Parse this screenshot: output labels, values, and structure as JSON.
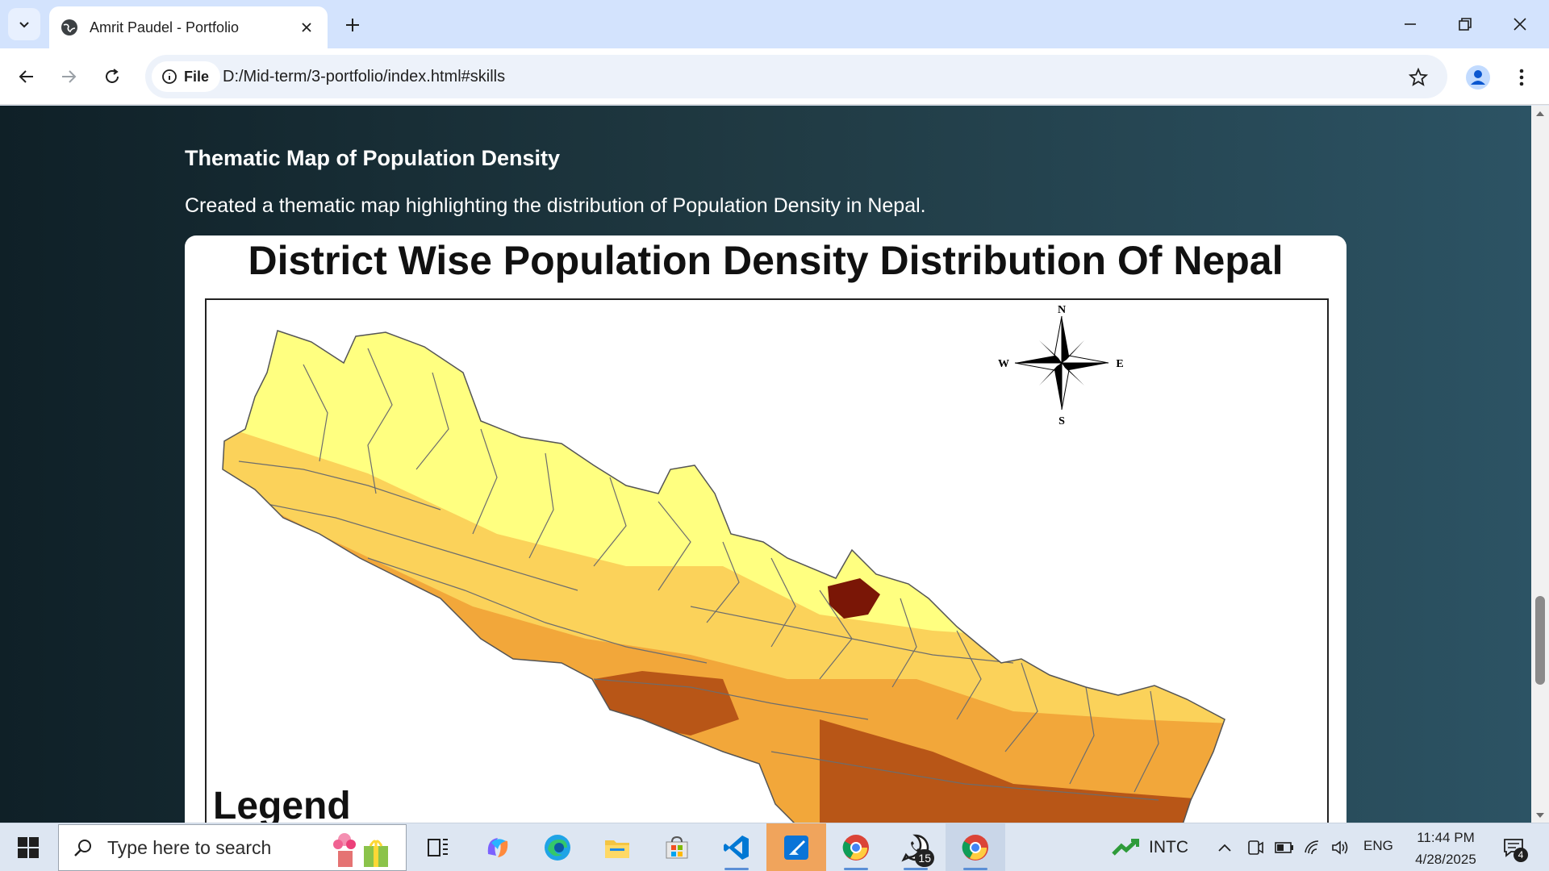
{
  "browser": {
    "tab": {
      "title": "Amrit Paudel - Portfolio"
    },
    "address": {
      "chip_label": "File",
      "url": "D:/Mid-term/3-portfolio/index.html#skills"
    }
  },
  "page": {
    "section_title": "Thematic Map of Population Density",
    "section_desc": "Created a thematic map highlighting the distribution of Population Density in Nepal.",
    "map": {
      "title": "District Wise Population Density Distribution Of Nepal",
      "compass": {
        "n": "N",
        "s": "S",
        "e": "E",
        "w": "W"
      },
      "legend_title": "Legend",
      "colors": [
        "#ffff80",
        "#fbd25a",
        "#f2a73a",
        "#b85617",
        "#7a1606"
      ]
    }
  },
  "taskbar": {
    "search_placeholder": "Type here to search",
    "apps": [
      {
        "name": "task-view-icon"
      },
      {
        "name": "copilot-icon"
      },
      {
        "name": "edge-icon"
      },
      {
        "name": "file-explorer-icon"
      },
      {
        "name": "microsoft-store-icon"
      },
      {
        "name": "vscode-icon"
      },
      {
        "name": "paint-icon"
      },
      {
        "name": "chrome-icon"
      },
      {
        "name": "whatsapp-icon",
        "badge": "15"
      },
      {
        "name": "chrome-icon"
      }
    ],
    "stock": {
      "ticker": "INTC"
    },
    "lang": "ENG",
    "time": "11:44 PM",
    "date": "4/28/2025",
    "notifications": "4"
  }
}
